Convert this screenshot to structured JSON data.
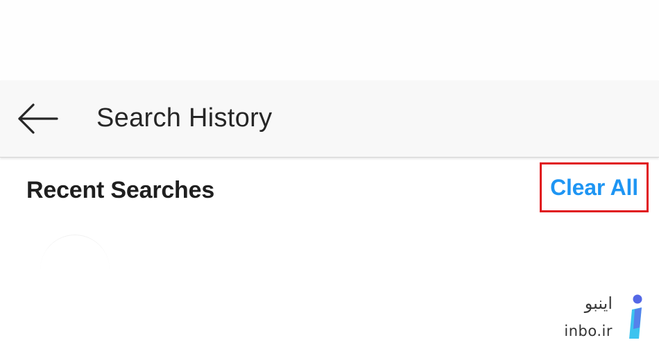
{
  "header": {
    "title": "Search History",
    "back_icon": "arrow-left-icon"
  },
  "recent": {
    "heading": "Recent Searches",
    "clear_all_label": "Clear All",
    "highlight_color": "#e0141b",
    "action_color": "#1e95f3"
  },
  "watermark": {
    "persian": "اینبو",
    "latin": "inbo.ir",
    "logo_icon": "inbo-i-logo-icon"
  }
}
